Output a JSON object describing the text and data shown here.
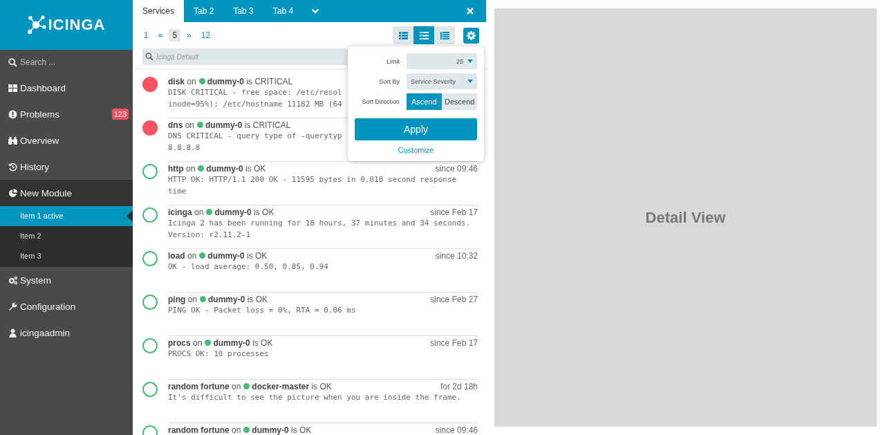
{
  "sidebar": {
    "logo": "ICINGA",
    "search": {
      "placeholder": "Search ..."
    },
    "items": [
      {
        "label": "Dashboard",
        "kind": "grid",
        "selected": false
      },
      {
        "label": "Problems",
        "kind": "alert",
        "badge": "123",
        "selected": false
      },
      {
        "label": "Overview",
        "kind": "binoculars",
        "selected": false
      },
      {
        "label": "History",
        "kind": "history",
        "selected": false
      },
      {
        "label": "New Module",
        "kind": "pie",
        "selected": true,
        "expanded": true,
        "children": [
          {
            "label": "Item 1 active",
            "selected": true
          },
          {
            "label": "Item 2",
            "selected": false
          },
          {
            "label": "Item 3",
            "selected": false
          }
        ]
      },
      {
        "label": "System",
        "kind": "gears",
        "selected": false
      },
      {
        "label": "Configuration",
        "kind": "wrench",
        "selected": false
      },
      {
        "label": "icingaadmin",
        "kind": "user",
        "selected": false
      }
    ]
  },
  "tabs": [
    {
      "label": "Services",
      "selected": true
    },
    {
      "label": "Tab 2",
      "selected": false
    },
    {
      "label": "Tab 3",
      "selected": false
    },
    {
      "label": "Tab 4",
      "selected": false
    }
  ],
  "pagination": [
    {
      "label": "1",
      "selected": false
    },
    {
      "label": "«",
      "selected": false
    },
    {
      "label": "5",
      "selected": true
    },
    {
      "label": "»",
      "selected": false
    },
    {
      "label": "12",
      "selected": false
    }
  ],
  "view_modes": [
    {
      "kind": "minimal",
      "selected": false
    },
    {
      "kind": "default",
      "selected": true
    },
    {
      "kind": "detailed",
      "selected": false
    }
  ],
  "filter": {
    "placeholder": "Icinga Default"
  },
  "settings_popup": {
    "limit_label": "Limit",
    "limit": "25",
    "sort_by_label": "Sort By",
    "sort_by": "Service Severity",
    "direction_label": "Sort Direction",
    "directions": [
      {
        "label": "Ascend",
        "selected": true
      },
      {
        "label": "Descend",
        "selected": false
      }
    ],
    "apply": "Apply",
    "customize": "Customize"
  },
  "services": [
    {
      "service": "**disk** on",
      "host": "**dummy-0** is CRITICAL",
      "kind": "critical",
      "output": "DISK CRITICAL - free space: /etc/resol\ninode=95%); /etc/hostname 11182 MB (64"
    },
    {
      "service": "**dns** on",
      "host": "**dummy-0** is CRITICAL",
      "kind": "critical",
      "output": "DNS CRITICAL - query type of -querytyp\n8.8.8.8"
    },
    {
      "service": "**http** on",
      "host": "**dummy-0** is OK",
      "kind": "ok",
      "since": "since 09:46",
      "output": "HTTP OK: HTTP/1.1 200 OK - 11595 bytes in 0.018 second response\ntime"
    },
    {
      "service": "**icinga** on",
      "host": "**dummy-0** is OK",
      "kind": "ok",
      "since": "since Feb 17",
      "output": "Icinga 2 has been running for 18 hours, 37 minutes and 34 seconds.\nVersion: r2.11.2-1"
    },
    {
      "service": "**load** on",
      "host": "**dummy-0** is OK",
      "kind": "ok",
      "since": "since 10:32",
      "output": "OK - load average: 0.50, 0.85, 0.94"
    },
    {
      "service": "**ping** on",
      "host": "**dummy-0** is OK",
      "kind": "ok",
      "since": "since Feb 27",
      "output": "PING OK - Packet loss = 0%, RTA = 0.06 ms"
    },
    {
      "service": "**procs** on",
      "host": "**dummy-0** is OK",
      "kind": "ok",
      "since": "since Feb 17",
      "output": "PROCS OK: 10 processes"
    },
    {
      "service": "**random fortune** on",
      "host": "**docker-master** is OK",
      "kind": "ok",
      "since": "for 2d 18h",
      "output": "It's difficult to see the picture when you are inside the frame."
    },
    {
      "service": "**random fortune** on",
      "host": "**dummy-0** is OK",
      "kind": "ok",
      "since": "since 09:46"
    }
  ],
  "detail": {
    "title": "Detail View"
  }
}
